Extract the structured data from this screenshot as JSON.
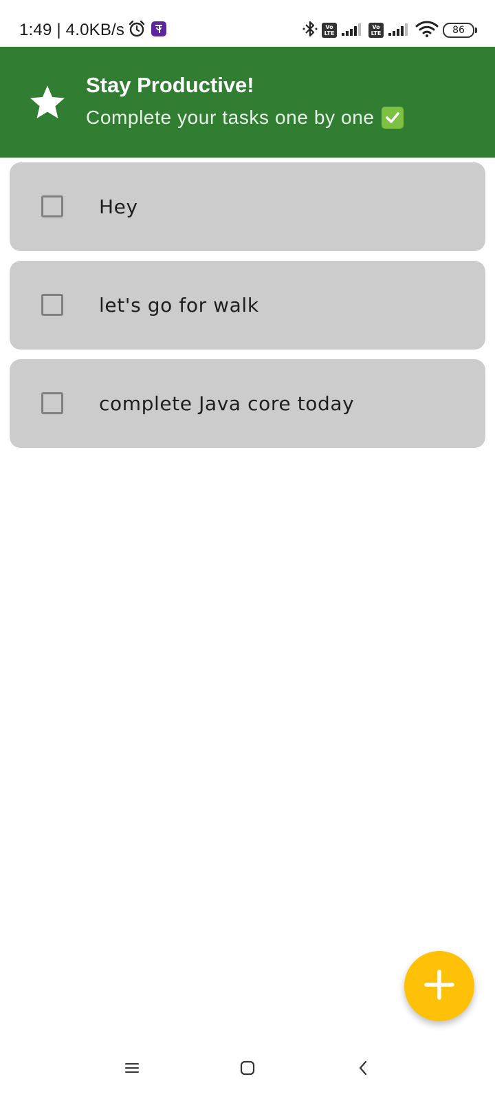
{
  "status_bar": {
    "time": "1:49 | 4.0KB/s",
    "icons_left": [
      "alarm-icon",
      "phonepe-app-icon"
    ],
    "icons_right": [
      "bluetooth-icon",
      "volte-icon",
      "signal-icon",
      "volte-icon",
      "signal-icon",
      "wifi-icon",
      "battery-icon"
    ],
    "volte_label_top": "Vo",
    "volte_label_bottom": "LTE",
    "battery_level": "86"
  },
  "header": {
    "icon": "star-icon",
    "title": "Stay Productive!",
    "subtitle": "Complete your tasks one by one",
    "subtitle_emoji": "check-mark-icon",
    "background_color": "#317e33"
  },
  "tasks": [
    {
      "text": "Hey",
      "checked": false
    },
    {
      "text": "let's go for walk",
      "checked": false
    },
    {
      "text": "complete Java core today",
      "checked": false
    }
  ],
  "fab": {
    "icon": "plus-icon",
    "color": "#ffc107"
  },
  "nav_bar": {
    "buttons": [
      "menu-icon",
      "home-icon",
      "back-icon"
    ]
  },
  "colors": {
    "card_background": "#cccccc",
    "checkbox_border": "#808080"
  }
}
